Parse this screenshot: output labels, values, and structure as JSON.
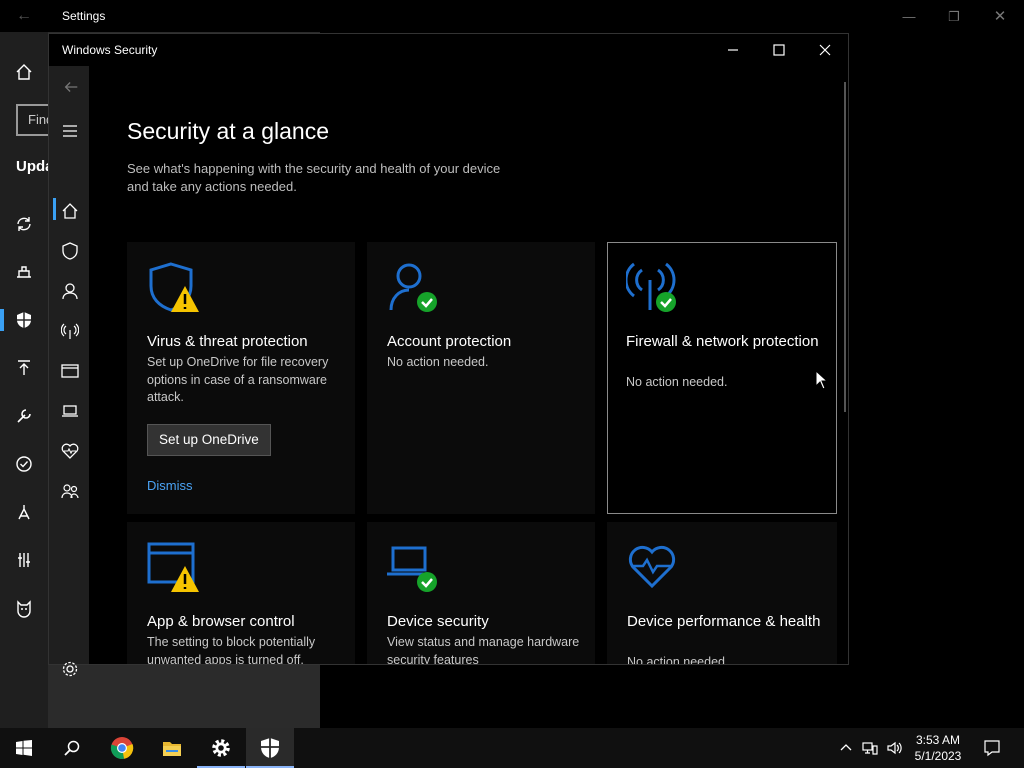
{
  "settings": {
    "title": "Settings",
    "search_placeholder": "Find",
    "section_label": "Update"
  },
  "security": {
    "window_title": "Windows Security",
    "page_title": "Security at a glance",
    "page_subtitle": "See what's happening with the security and health of your device and take any actions needed.",
    "cards": [
      {
        "title": "Virus & threat protection",
        "desc": "Set up OneDrive for file recovery options in case of a ransomware attack.",
        "button": "Set up OneDrive",
        "link": "Dismiss",
        "status": "warning",
        "icon": "shield-icon"
      },
      {
        "title": "Account protection",
        "desc": "No action needed.",
        "status": "ok",
        "icon": "person-icon"
      },
      {
        "title": "Firewall & network protection",
        "desc": "No action needed.",
        "status": "ok",
        "icon": "antenna-icon"
      },
      {
        "title": "App & browser control",
        "desc": "The setting to block potentially unwanted apps is turned off.",
        "status": "warning",
        "icon": "browser-window-icon"
      },
      {
        "title": "Device security",
        "desc": "View status and manage hardware security features",
        "status": "ok",
        "icon": "laptop-icon"
      },
      {
        "title": "Device performance & health",
        "desc": "No action needed.",
        "status": "none",
        "icon": "heart-pulse-icon"
      }
    ]
  },
  "taskbar": {
    "time": "3:53 AM",
    "date": "5/1/2023",
    "apps": [
      "start-icon",
      "search-icon",
      "chrome-icon",
      "file-explorer-icon",
      "settings-icon",
      "windows-security-icon"
    ]
  },
  "colors": {
    "accent": "#3aa0f3",
    "link": "#4aa3f5",
    "warning": "#f5c400",
    "ok": "#16a32a",
    "icon_blue": "#1e6fcf"
  }
}
